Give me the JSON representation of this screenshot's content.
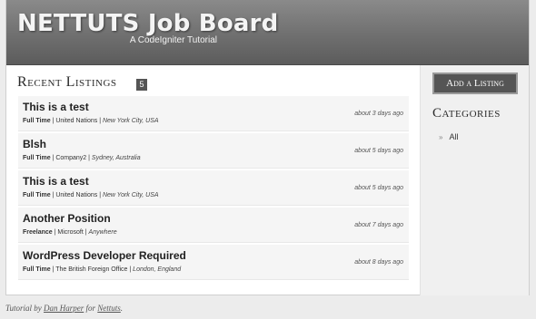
{
  "header": {
    "title": "NETTUTS Job Board",
    "tagline": "A CodeIgniter Tutorial"
  },
  "recent": {
    "title": "Recent Listings",
    "count": "5"
  },
  "listings": [
    {
      "title": "This is a test",
      "type": "Full Time",
      "company": "United Nations",
      "location": "New York City, USA",
      "age": "about 3 days ago"
    },
    {
      "title": "Blsh",
      "type": "Full Time",
      "company": "Company2",
      "location": "Sydney, Australia",
      "age": "about 5 days ago"
    },
    {
      "title": "This is a test",
      "type": "Full Time",
      "company": "United Nations",
      "location": "New York City, USA",
      "age": "about 5 days ago"
    },
    {
      "title": "Another Position",
      "type": "Freelance",
      "company": "Microsoft",
      "location": "Anywhere",
      "age": "about 7 days ago"
    },
    {
      "title": "WordPress Developer Required",
      "type": "Full Time",
      "company": "The British Foreign Office",
      "location": "London, England",
      "age": "about 8 days ago"
    }
  ],
  "sidebar": {
    "add_label": "Add a Listing",
    "categories_title": "Categories",
    "categories": [
      {
        "label": "All"
      }
    ]
  },
  "footer": {
    "prefix": "Tutorial by",
    "author": "Dan Harper",
    "middle": "for",
    "site": "Nettuts",
    "suffix": "."
  }
}
